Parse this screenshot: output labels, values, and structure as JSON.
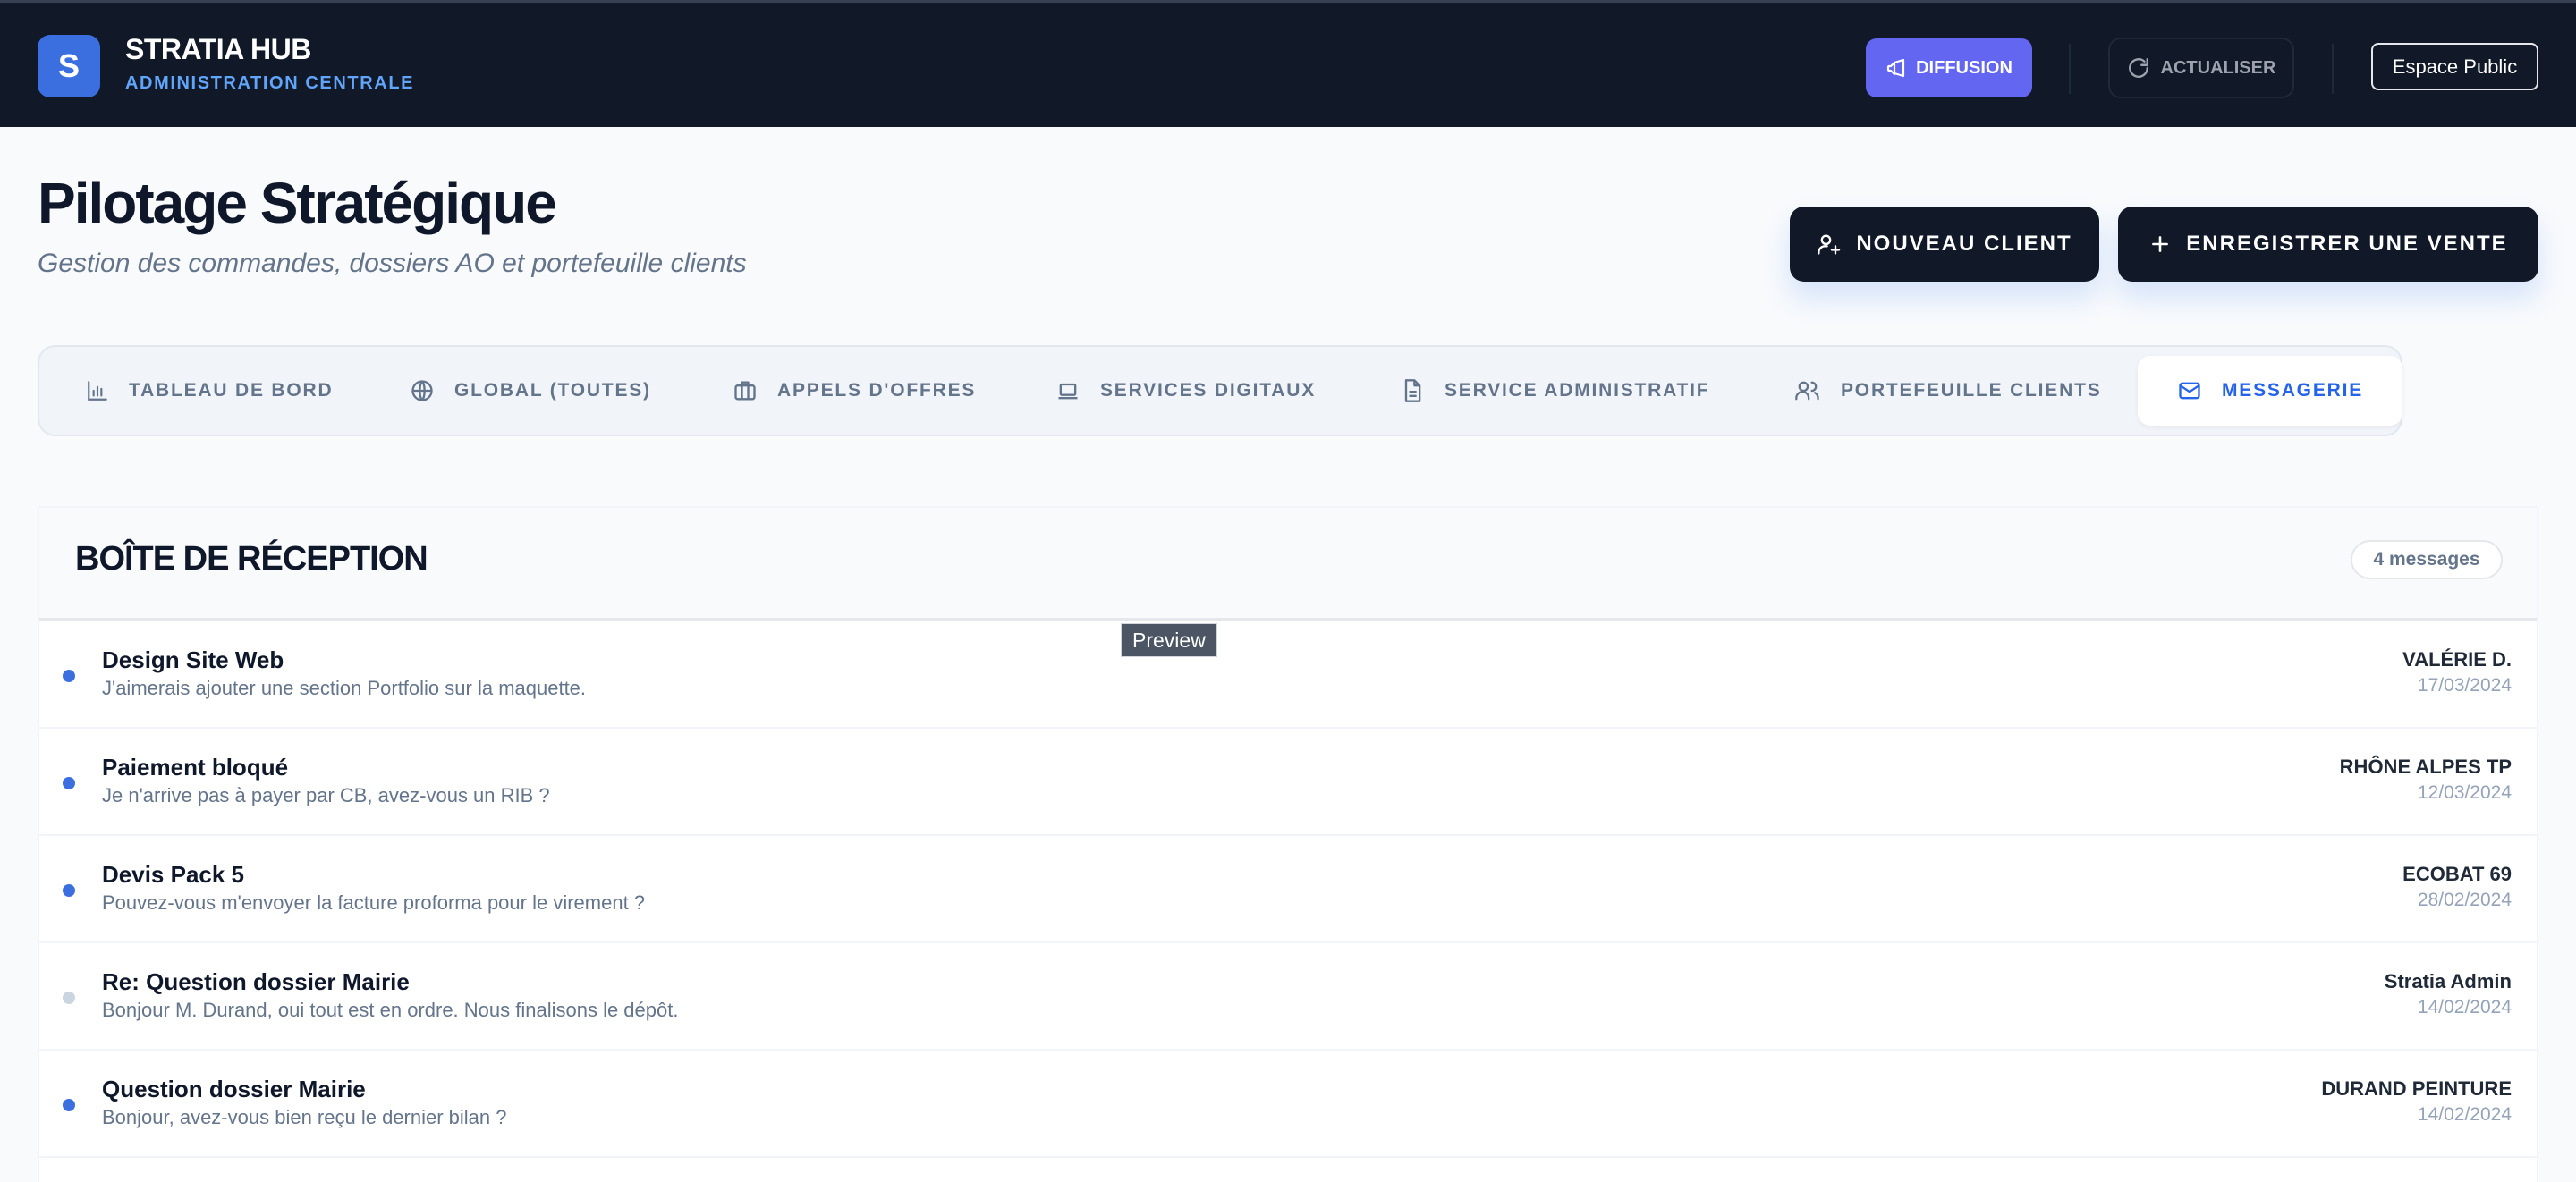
{
  "header": {
    "logo_letter": "S",
    "brand_title": "STRATIA HUB",
    "brand_subtitle": "ADMINISTRATION CENTRALE",
    "diffusion_label": "DIFFUSION",
    "refresh_label": "ACTUALISER",
    "public_label": "Espace Public"
  },
  "page": {
    "title": "Pilotage Stratégique",
    "subtitle": "Gestion des commandes, dossiers AO et portefeuille clients",
    "new_client_label": "NOUVEAU CLIENT",
    "new_sale_label": "ENREGISTRER UNE VENTE"
  },
  "tabs": [
    {
      "label": "TABLEAU DE BORD",
      "icon": "bar-chart-icon"
    },
    {
      "label": "GLOBAL (TOUTES)",
      "icon": "globe-icon"
    },
    {
      "label": "APPELS D'OFFRES",
      "icon": "briefcase-icon"
    },
    {
      "label": "SERVICES DIGITAUX",
      "icon": "laptop-icon"
    },
    {
      "label": "SERVICE ADMINISTRATIF",
      "icon": "document-icon"
    },
    {
      "label": "PORTEFEUILLE CLIENTS",
      "icon": "users-icon"
    },
    {
      "label": "MESSAGERIE",
      "icon": "mail-icon",
      "active": true
    }
  ],
  "inbox": {
    "title": "BOÎTE DE RÉCEPTION",
    "count_label": "4 messages",
    "tooltip": "Preview",
    "messages": [
      {
        "subject": "Design Site Web",
        "preview": "J'aimerais ajouter une section Portfolio sur la maquette.",
        "sender": "VALÉRIE D.",
        "date": "17/03/2024",
        "unread": true
      },
      {
        "subject": "Paiement bloqué",
        "preview": "Je n'arrive pas à payer par CB, avez-vous un RIB ?",
        "sender": "RHÔNE ALPES TP",
        "date": "12/03/2024",
        "unread": true
      },
      {
        "subject": "Devis Pack 5",
        "preview": "Pouvez-vous m'envoyer la facture proforma pour le virement ?",
        "sender": "ECOBAT 69",
        "date": "28/02/2024",
        "unread": true
      },
      {
        "subject": "Re: Question dossier Mairie",
        "preview": "Bonjour M. Durand, oui tout est en ordre. Nous finalisons le dépôt.",
        "sender": "Stratia Admin",
        "date": "14/02/2024",
        "unread": false
      },
      {
        "subject": "Question dossier Mairie",
        "preview": "Bonjour, avez-vous bien reçu le dernier bilan ?",
        "sender": "DURAND PEINTURE",
        "date": "14/02/2024",
        "unread": true
      }
    ]
  },
  "colors": {
    "header_bg": "#111827",
    "accent_blue": "#3b6fe0",
    "diffusion_purple": "#6366f1",
    "active_tab_text": "#2563eb",
    "unread_dot": "#3b6fe0",
    "read_dot": "#cbd5e1"
  }
}
